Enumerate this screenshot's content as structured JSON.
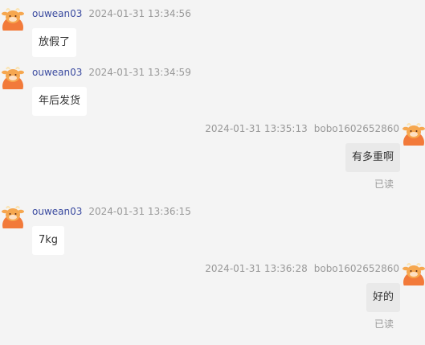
{
  "messages": [
    {
      "side": "left",
      "sender": "ouwean03",
      "time": "2024-01-31 13:34:56",
      "text": "放假了",
      "status": ""
    },
    {
      "side": "left",
      "sender": "ouwean03",
      "time": "2024-01-31 13:34:59",
      "text": "年后发货",
      "status": ""
    },
    {
      "side": "right",
      "sender": "bobo1602652860",
      "time": "2024-01-31 13:35:13",
      "text": "有多重啊",
      "status": "已读"
    },
    {
      "side": "left",
      "sender": "ouwean03",
      "time": "2024-01-31 13:36:15",
      "text": "7kg",
      "status": ""
    },
    {
      "side": "right",
      "sender": "bobo1602652860",
      "time": "2024-01-31 13:36:28",
      "text": "好的",
      "status": "已读"
    }
  ],
  "colors": {
    "background": "#f4f4f4",
    "sender_name": "#3b4ba0",
    "timestamp": "#999999",
    "incoming_bubble": "#ffffff",
    "outgoing_bubble": "#e9e9e9",
    "avatar_orange": "#f27a3a"
  },
  "icons": {
    "avatar": "cartoon-ox-avatar-icon"
  }
}
